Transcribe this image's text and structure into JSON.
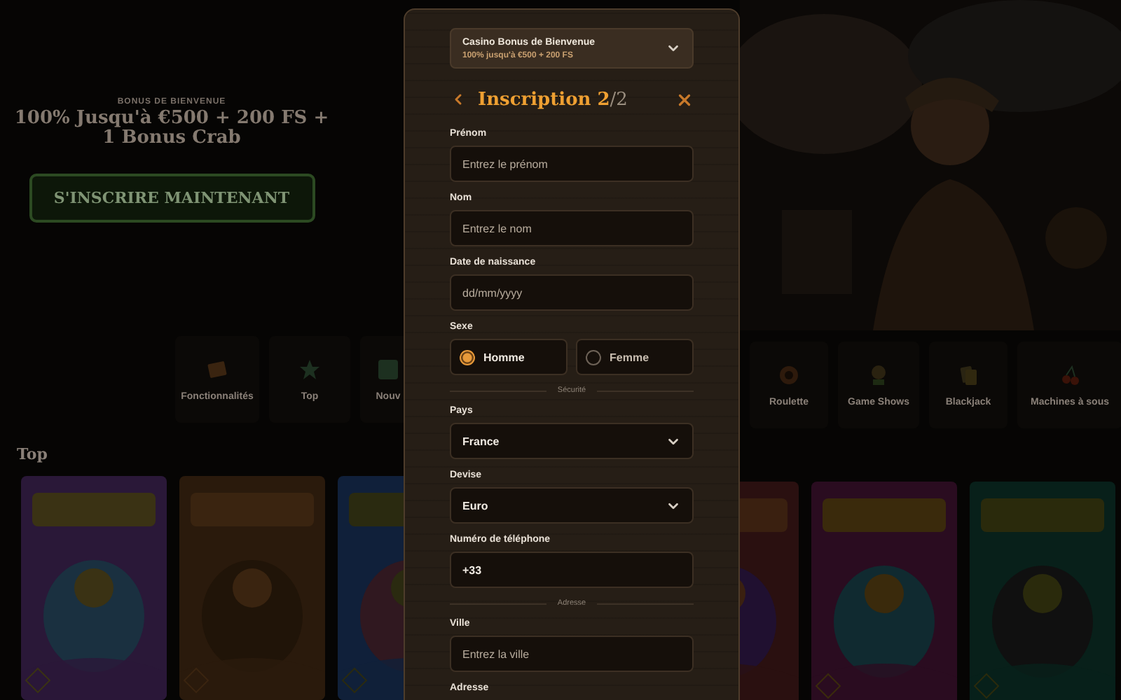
{
  "hero": {
    "eyebrow": "BONUS DE BIENVENUE",
    "headline": "100% Jusqu'à €500 + 200 FS + 1 Bonus Crab",
    "cta": "S'INSCRIRE MAINTENANT"
  },
  "categories_left": [
    {
      "label": "Fonctionnalités"
    },
    {
      "label": "Top"
    },
    {
      "label": "Nouv"
    }
  ],
  "categories_right": [
    {
      "label": "Roulette"
    },
    {
      "label": "Game Shows"
    },
    {
      "label": "Blackjack"
    },
    {
      "label": "Machines à sous"
    }
  ],
  "section_title": "Top",
  "modal": {
    "bonus_select": {
      "title": "Casino Bonus de Bienvenue",
      "subtitle": "100% jusqu'à €500 + 200 FS"
    },
    "title": "Inscription 2",
    "step_total": "/2",
    "fields": [
      {
        "kind": "text",
        "label": "Prénom",
        "placeholder": "Entrez le prénom"
      },
      {
        "kind": "text",
        "label": "Nom",
        "placeholder": "Entrez le nom"
      },
      {
        "kind": "text",
        "label": "Date de naissance",
        "placeholder": "dd/mm/yyyy"
      },
      {
        "kind": "radio",
        "label": "Sexe",
        "options": [
          {
            "label": "Homme",
            "selected": true
          },
          {
            "label": "Femme",
            "selected": false
          }
        ]
      },
      {
        "kind": "divider",
        "label": "Sécurité"
      },
      {
        "kind": "select",
        "label": "Pays",
        "value": "France"
      },
      {
        "kind": "select",
        "label": "Devise",
        "value": "Euro"
      },
      {
        "kind": "text",
        "label": "Numéro de téléphone",
        "value": "+33"
      },
      {
        "kind": "divider",
        "label": "Adresse"
      },
      {
        "kind": "text",
        "label": "Ville",
        "placeholder": "Entrez la ville"
      },
      {
        "kind": "label",
        "label": "Adresse"
      }
    ]
  }
}
